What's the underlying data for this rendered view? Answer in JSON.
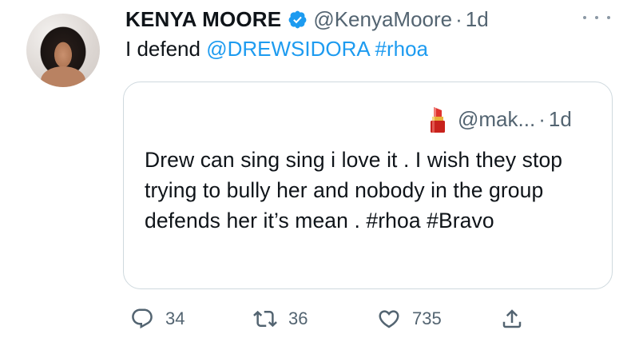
{
  "tweet": {
    "author_name": "KENYA MOORE",
    "handle": "@KenyaMoore",
    "separator": "·",
    "time": "1d",
    "text_prefix": "I defend ",
    "mention": "@DREWSIDORA",
    "hashtag": "#rhoa"
  },
  "quote": {
    "handle": "@mak...",
    "separator": "·",
    "time": "1d",
    "text": "Drew can sing sing i love it . I wish they stop trying to bully her and nobody in the group defends her it’s mean . #rhoa #Bravo"
  },
  "actions": {
    "replies": "34",
    "retweets": "36",
    "likes": "735"
  },
  "icons": {
    "verified": "verified-badge-icon",
    "more": "more-icon",
    "emoji": "lipstick-icon",
    "reply": "reply-icon",
    "retweet": "retweet-icon",
    "like": "heart-icon",
    "share": "share-icon"
  },
  "colors": {
    "accent": "#1d9bf0",
    "muted": "#536471",
    "text": "#0f1419",
    "border": "#cfd9de"
  }
}
